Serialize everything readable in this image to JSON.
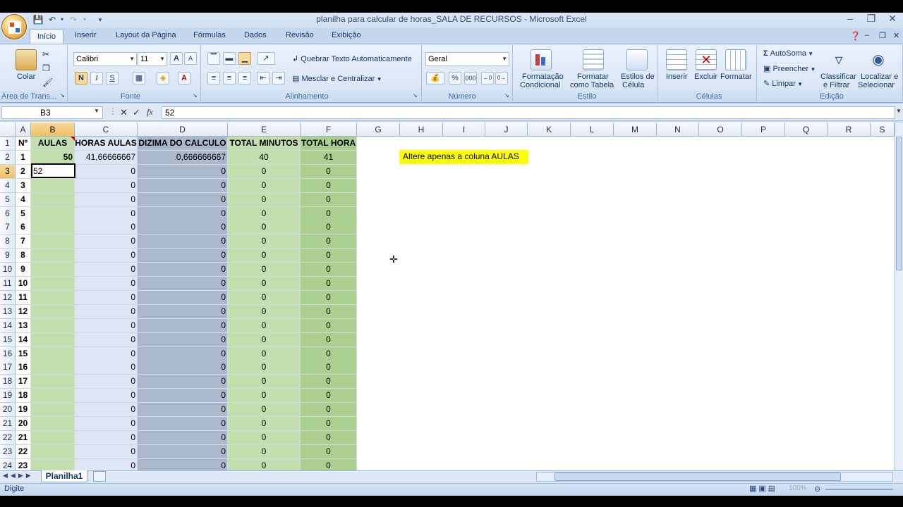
{
  "window": {
    "title": "planilha para calcular de horas_SALA DE RECURSOS - Microsoft Excel"
  },
  "tabs": [
    "Início",
    "Inserir",
    "Layout da Página",
    "Fórmulas",
    "Dados",
    "Revisão",
    "Exibição"
  ],
  "ribbon": {
    "clipboard": {
      "paste": "Colar",
      "label": "Área de Trans..."
    },
    "font": {
      "name": "Calibri",
      "size": "11",
      "bold": "N",
      "italic": "I",
      "underline": "S",
      "label": "Fonte"
    },
    "alignment": {
      "wrap": "Quebrar Texto Automaticamente",
      "merge": "Mesclar e Centralizar",
      "label": "Alinhamento"
    },
    "number": {
      "format": "Geral",
      "percent": "%",
      "thousands": "000",
      "label": "Número"
    },
    "styles": {
      "cond_l1": "Formatação",
      "cond_l2": "Condicional",
      "table_l1": "Formatar",
      "table_l2": "como Tabela",
      "cell_l1": "Estilos de",
      "cell_l2": "Célula",
      "label": "Estilo"
    },
    "cells": {
      "insert": "Inserir",
      "delete": "Excluir",
      "format": "Formatar",
      "label": "Células"
    },
    "editing": {
      "autosum": "AutoSoma",
      "fill": "Preencher",
      "clear": "Limpar",
      "sort_l1": "Classificar",
      "sort_l2": "e Filtrar",
      "find_l1": "Localizar e",
      "find_l2": "Selecionar",
      "label": "Edição"
    }
  },
  "formula_bar": {
    "name_box": "B3",
    "fx": "fx",
    "value": "52"
  },
  "columns": [
    "A",
    "B",
    "C",
    "D",
    "E",
    "F",
    "G",
    "H",
    "I",
    "J",
    "K",
    "L",
    "M",
    "N",
    "O",
    "P",
    "Q",
    "R",
    "S"
  ],
  "headers": [
    "Nº",
    "AULAS",
    "HORAS AULAS",
    "DIZIMA DO CALCULO",
    "TOTAL MINUTOS",
    "TOTAL HORA"
  ],
  "rows": [
    {
      "n": "1",
      "aulas": "50",
      "horas": "41,66666667",
      "dizima": "0,666666667",
      "min": "40",
      "hora": "41"
    },
    {
      "n": "2",
      "aulas": "52",
      "horas": "0",
      "dizima": "0",
      "min": "0",
      "hora": "0"
    },
    {
      "n": "3",
      "aulas": "",
      "horas": "0",
      "dizima": "0",
      "min": "0",
      "hora": "0"
    },
    {
      "n": "4",
      "aulas": "",
      "horas": "0",
      "dizima": "0",
      "min": "0",
      "hora": "0"
    },
    {
      "n": "5",
      "aulas": "",
      "horas": "0",
      "dizima": "0",
      "min": "0",
      "hora": "0"
    },
    {
      "n": "6",
      "aulas": "",
      "horas": "0",
      "dizima": "0",
      "min": "0",
      "hora": "0"
    },
    {
      "n": "7",
      "aulas": "",
      "horas": "0",
      "dizima": "0",
      "min": "0",
      "hora": "0"
    },
    {
      "n": "8",
      "aulas": "",
      "horas": "0",
      "dizima": "0",
      "min": "0",
      "hora": "0"
    },
    {
      "n": "9",
      "aulas": "",
      "horas": "0",
      "dizima": "0",
      "min": "0",
      "hora": "0"
    },
    {
      "n": "10",
      "aulas": "",
      "horas": "0",
      "dizima": "0",
      "min": "0",
      "hora": "0"
    },
    {
      "n": "11",
      "aulas": "",
      "horas": "0",
      "dizima": "0",
      "min": "0",
      "hora": "0"
    },
    {
      "n": "12",
      "aulas": "",
      "horas": "0",
      "dizima": "0",
      "min": "0",
      "hora": "0"
    },
    {
      "n": "13",
      "aulas": "",
      "horas": "0",
      "dizima": "0",
      "min": "0",
      "hora": "0"
    },
    {
      "n": "14",
      "aulas": "",
      "horas": "0",
      "dizima": "0",
      "min": "0",
      "hora": "0"
    },
    {
      "n": "15",
      "aulas": "",
      "horas": "0",
      "dizima": "0",
      "min": "0",
      "hora": "0"
    },
    {
      "n": "16",
      "aulas": "",
      "horas": "0",
      "dizima": "0",
      "min": "0",
      "hora": "0"
    },
    {
      "n": "17",
      "aulas": "",
      "horas": "0",
      "dizima": "0",
      "min": "0",
      "hora": "0"
    },
    {
      "n": "18",
      "aulas": "",
      "horas": "0",
      "dizima": "0",
      "min": "0",
      "hora": "0"
    },
    {
      "n": "19",
      "aulas": "",
      "horas": "0",
      "dizima": "0",
      "min": "0",
      "hora": "0"
    },
    {
      "n": "20",
      "aulas": "",
      "horas": "0",
      "dizima": "0",
      "min": "0",
      "hora": "0"
    },
    {
      "n": "21",
      "aulas": "",
      "horas": "0",
      "dizima": "0",
      "min": "0",
      "hora": "0"
    },
    {
      "n": "22",
      "aulas": "",
      "horas": "0",
      "dizima": "0",
      "min": "0",
      "hora": "0"
    },
    {
      "n": "23",
      "aulas": "",
      "horas": "0",
      "dizima": "0",
      "min": "0",
      "hora": "0"
    }
  ],
  "note": "Altere apenas a coluna AULAS",
  "sheet_tab": "Planilha1",
  "status": "Digite",
  "zoom": "100%"
}
